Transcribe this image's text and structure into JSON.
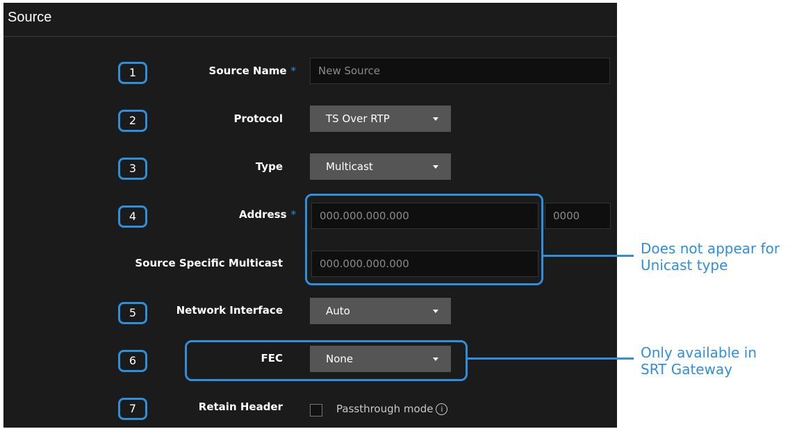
{
  "panel": {
    "title": "Source"
  },
  "fields": {
    "source_name": {
      "number": "1",
      "label": "Source Name",
      "required_mark": "*",
      "placeholder": "New Source"
    },
    "protocol": {
      "number": "2",
      "label": "Protocol",
      "value": "TS Over RTP"
    },
    "type": {
      "number": "3",
      "label": "Type",
      "value": "Multicast"
    },
    "address": {
      "number": "4",
      "label": "Address",
      "required_mark": "*",
      "ip_placeholder": "000.000.000.000",
      "port_placeholder": "0000"
    },
    "ssm": {
      "label": "Source Specific Multicast",
      "placeholder": "000.000.000.000"
    },
    "network_interface": {
      "number": "5",
      "label": "Network Interface",
      "value": "Auto"
    },
    "fec": {
      "number": "6",
      "label": "FEC",
      "value": "None"
    },
    "retain_header": {
      "number": "7",
      "label": "Retain Header",
      "checkbox_label": "Passthrough mode",
      "checked": false,
      "info_glyph": "i"
    }
  },
  "notes": {
    "multicast_note_line1": "Does not appear for",
    "multicast_note_line2": "Unicast type",
    "fec_note_line1": "Only available in",
    "fec_note_line2": "SRT Gateway"
  },
  "colors": {
    "accent": "#2f8fdc",
    "panel_bg": "#1b1b1b",
    "select_bg": "#555555",
    "input_bg": "#0f0f0f"
  },
  "icons": {
    "dropdown": "chevron-down-icon",
    "info": "info-icon"
  }
}
